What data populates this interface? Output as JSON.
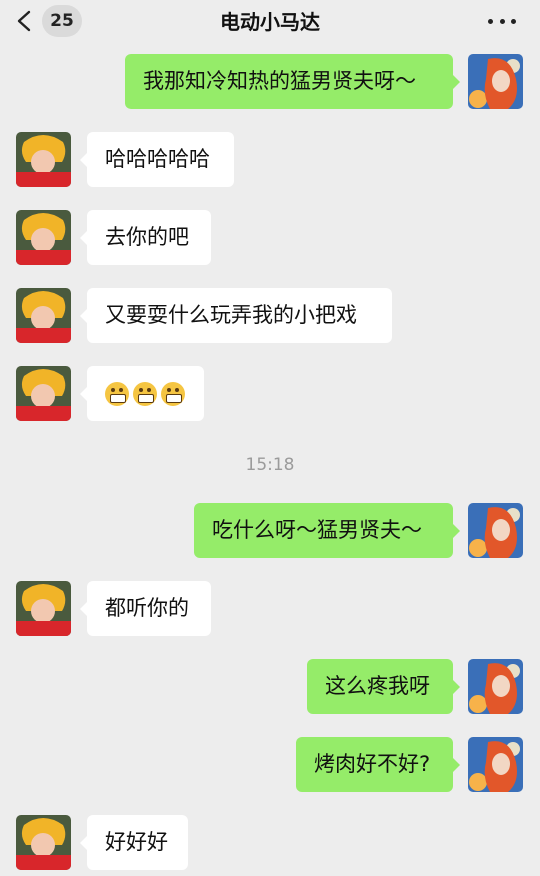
{
  "header": {
    "title": "电动小马达",
    "unread_count": "25"
  },
  "timestamp": "15:18",
  "messages": [
    {
      "side": "right",
      "text": "我那知冷知热的猛男贤夫呀～"
    },
    {
      "side": "left",
      "text": "哈哈哈哈哈"
    },
    {
      "side": "left",
      "text": "去你的吧"
    },
    {
      "side": "left",
      "text": "又要耍什么玩弄我的小把戏"
    },
    {
      "side": "left",
      "emoji": [
        "grimacing-face",
        "grimacing-face",
        "grimacing-face"
      ]
    },
    {
      "side": "right",
      "text": "吃什么呀～猛男贤夫～"
    },
    {
      "side": "left",
      "text": "都听你的"
    },
    {
      "side": "right",
      "text": "这么疼我呀"
    },
    {
      "side": "right",
      "text": "烤肉好不好?"
    },
    {
      "side": "left",
      "text": "好好好"
    }
  ],
  "colors": {
    "background": "#ededed",
    "sent_bubble": "#95ec69",
    "received_bubble": "#ffffff",
    "timestamp_text": "#9b9b9b"
  },
  "icons": {
    "back": "chevron-left-icon",
    "more": "more-dots-icon",
    "contact_avatar": "avatar",
    "self_avatar": "avatar"
  }
}
